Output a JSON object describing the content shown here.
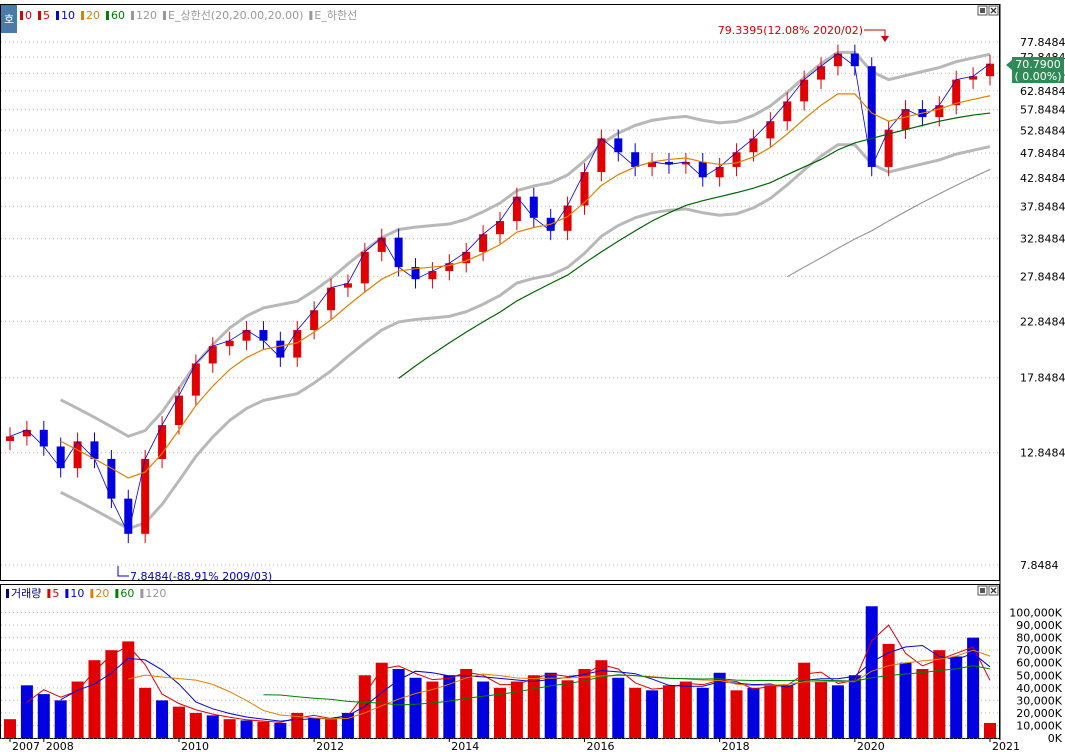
{
  "price_panel": {
    "badge": "호",
    "legend": [
      {
        "label": "0",
        "color": "#e00000"
      },
      {
        "label": "5",
        "color": "#e00000"
      },
      {
        "label": "10",
        "color": "#0000e0"
      },
      {
        "label": "20",
        "color": "#e08000"
      },
      {
        "label": "60",
        "color": "#008000"
      },
      {
        "label": "120",
        "color": "#999999"
      },
      {
        "label": "E_상한선(20,20.00,20.00)",
        "color": "#999999"
      },
      {
        "label": "E_하한선",
        "color": "#999999"
      }
    ],
    "current_price": "70.7900",
    "current_change": "( 0.00%)",
    "high_annotation": "79.3395(12.08% 2020/02)",
    "low_annotation": "7.8484(-88.91% 2009/03)"
  },
  "volume_panel": {
    "legend": [
      {
        "label": "거래량",
        "color": "#000080"
      },
      {
        "label": "5",
        "color": "#e00000"
      },
      {
        "label": "10",
        "color": "#0000e0"
      },
      {
        "label": "20",
        "color": "#e08000"
      },
      {
        "label": "60",
        "color": "#008000"
      },
      {
        "label": "120",
        "color": "#999999"
      }
    ]
  },
  "chart_data": [
    {
      "type": "line",
      "title": "",
      "scale": "log",
      "y_ticks": [
        "77.8484",
        "72.8484",
        "67.8484",
        "62.8484",
        "57.8484",
        "52.8484",
        "47.8484",
        "42.8484",
        "37.8484",
        "32.8484",
        "27.8484",
        "22.8484",
        "17.8484",
        "12.8484",
        "7.8484"
      ],
      "x_ticks": [
        "2007",
        "2008",
        "2010",
        "2012",
        "2014",
        "2016",
        "2018",
        "2020",
        "2021"
      ],
      "dates": [
        "2007/07",
        "2007/10",
        "2008/01",
        "2008/04",
        "2008/07",
        "2008/10",
        "2009/01",
        "2009/03",
        "2009/07",
        "2009/10",
        "2010/01",
        "2010/04",
        "2010/07",
        "2010/10",
        "2011/01",
        "2011/04",
        "2011/07",
        "2011/10",
        "2012/01",
        "2012/04",
        "2012/07",
        "2012/10",
        "2013/01",
        "2013/04",
        "2013/07",
        "2013/10",
        "2014/01",
        "2014/04",
        "2014/07",
        "2014/10",
        "2015/01",
        "2015/04",
        "2015/07",
        "2015/10",
        "2016/01",
        "2016/04",
        "2016/07",
        "2016/10",
        "2017/01",
        "2017/04",
        "2017/07",
        "2017/10",
        "2018/01",
        "2018/04",
        "2018/07",
        "2018/10",
        "2019/01",
        "2019/04",
        "2019/07",
        "2019/10",
        "2020/01",
        "2020/03",
        "2020/06",
        "2020/09",
        "2021/01",
        "2021/04",
        "2021/07",
        "2021/10",
        "2021/12"
      ],
      "series": [
        {
          "name": "0",
          "values": [
            13.8,
            14.2,
            13.2,
            12.0,
            13.5,
            12.5,
            10.5,
            9.0,
            12.5,
            14.5,
            16.5,
            19.0,
            20.5,
            21.0,
            22.0,
            21.0,
            19.5,
            22.0,
            24.0,
            26.5,
            27.0,
            31.0,
            33.0,
            29.0,
            27.5,
            28.5,
            29.5,
            31.0,
            33.5,
            35.5,
            39.5,
            36.0,
            34.0,
            38.0,
            44.0,
            51.0,
            48.0,
            45.0,
            46.0,
            45.5,
            46.0,
            43.0,
            45.0,
            48.0,
            51.0,
            55.0,
            60.0,
            66.0,
            70.0,
            74.0,
            70.0,
            45.0,
            53.0,
            58.0,
            56.0,
            59.0,
            66.0,
            67.0,
            70.79
          ]
        },
        {
          "name": "20",
          "values": [
            null,
            null,
            null,
            13.5,
            13.0,
            12.5,
            12.0,
            11.5,
            11.8,
            12.8,
            14.2,
            15.8,
            17.2,
            18.5,
            19.5,
            20.2,
            20.5,
            20.8,
            21.8,
            23.0,
            24.5,
            26.0,
            27.5,
            28.5,
            28.8,
            29.0,
            29.2,
            29.8,
            30.8,
            32.0,
            33.8,
            34.5,
            35.0,
            36.2,
            38.5,
            41.5,
            43.5,
            45.0,
            46.0,
            46.5,
            46.8,
            46.0,
            45.5,
            45.8,
            47.0,
            49.0,
            52.0,
            55.5,
            59.0,
            62.0,
            62.0,
            57.0,
            55.0,
            56.0,
            57.0,
            58.0,
            59.5,
            60.5,
            61.5
          ]
        },
        {
          "name": "60",
          "values": [
            null,
            null,
            null,
            null,
            null,
            null,
            null,
            null,
            null,
            null,
            null,
            null,
            null,
            null,
            null,
            null,
            null,
            null,
            null,
            null,
            null,
            null,
            null,
            17.8,
            18.8,
            19.8,
            20.8,
            21.8,
            22.8,
            23.8,
            25.0,
            26.0,
            27.0,
            28.0,
            29.5,
            31.0,
            32.5,
            34.0,
            35.5,
            36.8,
            38.0,
            38.8,
            39.5,
            40.2,
            41.0,
            42.0,
            43.5,
            45.0,
            46.5,
            48.5,
            50.0,
            51.0,
            52.0,
            53.0,
            54.0,
            55.0,
            55.8,
            56.5,
            57.0
          ]
        },
        {
          "name": "120",
          "values": [
            null,
            null,
            null,
            null,
            null,
            null,
            null,
            null,
            null,
            null,
            null,
            null,
            null,
            null,
            null,
            null,
            null,
            null,
            null,
            null,
            null,
            null,
            null,
            null,
            null,
            null,
            null,
            null,
            null,
            null,
            null,
            null,
            null,
            null,
            null,
            null,
            null,
            null,
            null,
            null,
            null,
            null,
            null,
            null,
            null,
            null,
            27.8,
            29.0,
            30.2,
            31.5,
            32.8,
            34.0,
            35.5,
            37.0,
            38.5,
            40.0,
            41.5,
            43.0,
            44.5
          ]
        }
      ]
    },
    {
      "type": "bar",
      "title": "거래량",
      "y_ticks": [
        "100,000K",
        "90,000K",
        "80,000K",
        "70,000K",
        "60,000K",
        "50,000K",
        "40,000K",
        "30,000K",
        "20,000K",
        "10,000K",
        "0K"
      ],
      "ylim": [
        0,
        110000
      ],
      "unit": "K",
      "dates": [
        "2007/07",
        "2007/10",
        "2008/01",
        "2008/04",
        "2008/07",
        "2008/10",
        "2009/01",
        "2009/03",
        "2009/07",
        "2009/10",
        "2010/01",
        "2010/04",
        "2010/07",
        "2010/10",
        "2011/01",
        "2011/04",
        "2011/07",
        "2011/10",
        "2012/01",
        "2012/04",
        "2012/07",
        "2012/10",
        "2013/01",
        "2013/04",
        "2013/07",
        "2013/10",
        "2014/01",
        "2014/04",
        "2014/07",
        "2014/10",
        "2015/01",
        "2015/04",
        "2015/07",
        "2015/10",
        "2016/01",
        "2016/04",
        "2016/07",
        "2016/10",
        "2017/01",
        "2017/04",
        "2017/07",
        "2017/10",
        "2018/01",
        "2018/04",
        "2018/07",
        "2018/10",
        "2019/01",
        "2019/04",
        "2019/07",
        "2019/10",
        "2020/01",
        "2020/03",
        "2020/06",
        "2020/09",
        "2021/01",
        "2021/04",
        "2021/07",
        "2021/10",
        "2021/12"
      ],
      "values": [
        15000,
        42000,
        35000,
        30000,
        45000,
        62000,
        70000,
        77000,
        40000,
        30000,
        25000,
        20000,
        18000,
        15000,
        14000,
        13000,
        12000,
        20000,
        16000,
        15000,
        20000,
        50000,
        60000,
        55000,
        48000,
        45000,
        50000,
        55000,
        45000,
        40000,
        45000,
        50000,
        52000,
        46000,
        55000,
        62000,
        48000,
        40000,
        38000,
        42000,
        45000,
        40000,
        52000,
        38000,
        40000,
        42000,
        42000,
        60000,
        45000,
        42000,
        50000,
        105000,
        75000,
        60000,
        55000,
        70000,
        65000,
        80000,
        12000
      ],
      "up": [
        true,
        false,
        false,
        false,
        true,
        true,
        true,
        true,
        true,
        false,
        true,
        true,
        false,
        true,
        false,
        true,
        false,
        true,
        false,
        true,
        false,
        true,
        true,
        false,
        false,
        true,
        false,
        true,
        false,
        true,
        true,
        true,
        false,
        true,
        true,
        true,
        false,
        true,
        false,
        true,
        true,
        false,
        false,
        true,
        false,
        true,
        true,
        true,
        true,
        false,
        false,
        false,
        true,
        false,
        true,
        true,
        false,
        false,
        true
      ]
    }
  ]
}
